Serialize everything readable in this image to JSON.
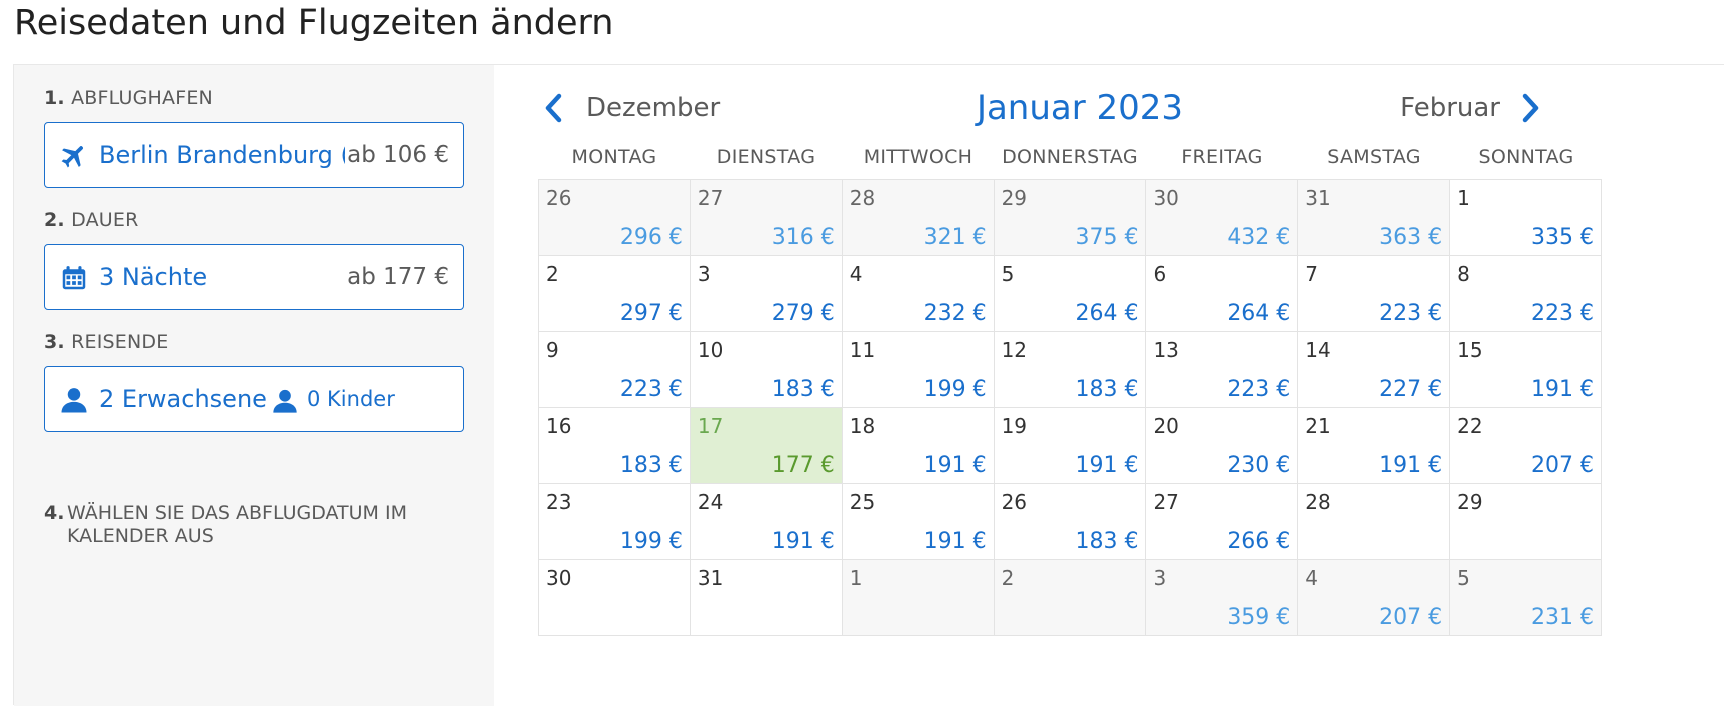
{
  "page": {
    "title": "Reisedaten und Flugzeiten ändern"
  },
  "colors": {
    "accent": "#1a6fcc",
    "selected_bg": "#e0efd3",
    "selected_text": "#5a9a2e"
  },
  "sidebar": {
    "step1": {
      "num": "1.",
      "label": "ABFLUGHAFEN",
      "value": "Berlin Brandenburg (...",
      "price": "ab 106 €",
      "icon": "airplane-icon"
    },
    "step2": {
      "num": "2.",
      "label": "DAUER",
      "value": "3 Nächte",
      "price": "ab 177 €",
      "icon": "calendar-icon"
    },
    "step3": {
      "num": "3.",
      "label": "REISENDE",
      "adults": "2 Erwachsene",
      "kids": "0 Kinder",
      "icon": "person-icon"
    },
    "step4": {
      "num": "4.",
      "label": "WÄHLEN SIE DAS ABFLUGDATUM IM KALENDER AUS"
    }
  },
  "calendar": {
    "prev_month": "Dezember",
    "current_month": "Januar 2023",
    "next_month": "Februar",
    "weekdays": [
      "MONTAG",
      "DIENSTAG",
      "MITTWOCH",
      "DONNERSTAG",
      "FREITAG",
      "SAMSTAG",
      "SONNTAG"
    ],
    "weeks": [
      [
        {
          "day": "26",
          "price": "296 €",
          "other": true
        },
        {
          "day": "27",
          "price": "316 €",
          "other": true
        },
        {
          "day": "28",
          "price": "321 €",
          "other": true
        },
        {
          "day": "29",
          "price": "375 €",
          "other": true
        },
        {
          "day": "30",
          "price": "432 €",
          "other": true
        },
        {
          "day": "31",
          "price": "363 €",
          "other": true
        },
        {
          "day": "1",
          "price": "335 €"
        }
      ],
      [
        {
          "day": "2",
          "price": "297 €"
        },
        {
          "day": "3",
          "price": "279 €"
        },
        {
          "day": "4",
          "price": "232 €"
        },
        {
          "day": "5",
          "price": "264 €"
        },
        {
          "day": "6",
          "price": "264 €"
        },
        {
          "day": "7",
          "price": "223 €"
        },
        {
          "day": "8",
          "price": "223 €"
        }
      ],
      [
        {
          "day": "9",
          "price": "223 €"
        },
        {
          "day": "10",
          "price": "183 €"
        },
        {
          "day": "11",
          "price": "199 €"
        },
        {
          "day": "12",
          "price": "183 €"
        },
        {
          "day": "13",
          "price": "223 €"
        },
        {
          "day": "14",
          "price": "227 €"
        },
        {
          "day": "15",
          "price": "191 €"
        }
      ],
      [
        {
          "day": "16",
          "price": "183 €"
        },
        {
          "day": "17",
          "price": "177 €",
          "selected": true
        },
        {
          "day": "18",
          "price": "191 €"
        },
        {
          "day": "19",
          "price": "191 €"
        },
        {
          "day": "20",
          "price": "230 €"
        },
        {
          "day": "21",
          "price": "191 €"
        },
        {
          "day": "22",
          "price": "207 €"
        }
      ],
      [
        {
          "day": "23",
          "price": "199 €"
        },
        {
          "day": "24",
          "price": "191 €"
        },
        {
          "day": "25",
          "price": "191 €"
        },
        {
          "day": "26",
          "price": "183 €"
        },
        {
          "day": "27",
          "price": "266 €"
        },
        {
          "day": "28",
          "price": ""
        },
        {
          "day": "29",
          "price": ""
        }
      ],
      [
        {
          "day": "30",
          "price": ""
        },
        {
          "day": "31",
          "price": ""
        },
        {
          "day": "1",
          "price": "",
          "other": true
        },
        {
          "day": "2",
          "price": "",
          "other": true
        },
        {
          "day": "3",
          "price": "359 €",
          "other": true
        },
        {
          "day": "4",
          "price": "207 €",
          "other": true
        },
        {
          "day": "5",
          "price": "231 €",
          "other": true
        }
      ]
    ]
  }
}
